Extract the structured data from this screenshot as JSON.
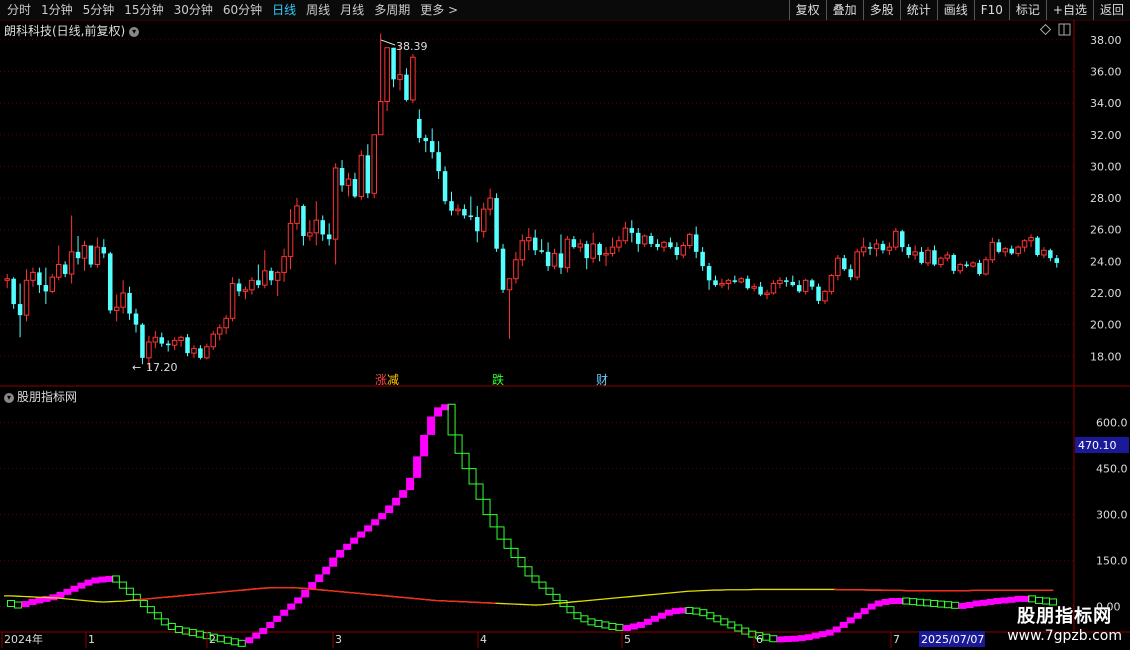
{
  "toolbar": {
    "periods": [
      {
        "label": "分时",
        "active": false
      },
      {
        "label": "1分钟",
        "active": false
      },
      {
        "label": "5分钟",
        "active": false
      },
      {
        "label": "15分钟",
        "active": false
      },
      {
        "label": "30分钟",
        "active": false
      },
      {
        "label": "60分钟",
        "active": false
      },
      {
        "label": "日线",
        "active": true
      },
      {
        "label": "周线",
        "active": false
      },
      {
        "label": "月线",
        "active": false
      },
      {
        "label": "多周期",
        "active": false
      },
      {
        "label": "更多 >",
        "active": false
      }
    ],
    "actions": [
      "复权",
      "叠加",
      "多股",
      "统计",
      "画线",
      "F10",
      "标记",
      "+自选",
      "返回"
    ]
  },
  "price_panel": {
    "title": "朗科科技(日线,前复权)",
    "high_label": "38.39",
    "low_label": "17.20",
    "axis_ticks": [
      "38.00",
      "36.00",
      "34.00",
      "32.00",
      "30.00",
      "28.00",
      "26.00",
      "24.00",
      "22.00",
      "20.00",
      "18.00"
    ],
    "events": [
      {
        "text": "涨",
        "color": "#ff4444"
      },
      {
        "text": "减",
        "color": "#ffcc00"
      },
      {
        "text": "跌",
        "color": "#33ff33"
      },
      {
        "text": "财",
        "color": "#66ccff"
      }
    ]
  },
  "indicator_panel": {
    "title": "股朋指标网",
    "axis_ticks": [
      "600.0",
      "450.0",
      "300.0",
      "150.0",
      "0.00"
    ],
    "current_value": "470.10"
  },
  "time_axis": {
    "labels": [
      "2024年",
      "1",
      "2",
      "3",
      "4",
      "5",
      "6",
      "7"
    ],
    "cursor_date": "2025/07/07"
  },
  "watermark": {
    "title": "股朋指标网",
    "url": "www.7gpzb.com"
  },
  "colors": {
    "up": "#ff3333",
    "down": "#54ffff",
    "pink": "#ff00ff",
    "green": "#33ff33",
    "grid": "#5a0000",
    "axis_border": "#8b0000"
  },
  "chart_data": {
    "type": "candlestick",
    "price_range": [
      16.5,
      39.0
    ],
    "indicator_range": [
      -60,
      700
    ],
    "price_ticks": [
      18,
      20,
      22,
      24,
      26,
      28,
      30,
      32,
      34,
      36,
      38
    ],
    "indicator_ticks": [
      0,
      150,
      300,
      450,
      600
    ],
    "candles": [
      [
        22.8,
        23.2,
        22.3,
        22.9
      ],
      [
        22.9,
        23.0,
        21.0,
        21.3
      ],
      [
        21.3,
        22.6,
        19.2,
        20.6
      ],
      [
        20.6,
        23.5,
        20.2,
        22.8
      ],
      [
        22.8,
        23.6,
        22.4,
        23.3
      ],
      [
        23.3,
        23.6,
        22.0,
        22.5
      ],
      [
        22.5,
        23.6,
        21.3,
        22.1
      ],
      [
        22.1,
        23.2,
        22.0,
        23.0
      ],
      [
        23.0,
        25.0,
        22.8,
        23.8
      ],
      [
        23.8,
        24.0,
        23.0,
        23.2
      ],
      [
        23.2,
        26.9,
        22.6,
        24.6
      ],
      [
        24.6,
        25.6,
        23.8,
        24.2
      ],
      [
        24.2,
        25.3,
        23.4,
        25.0
      ],
      [
        25.0,
        25.0,
        23.6,
        23.8
      ],
      [
        23.8,
        25.5,
        23.6,
        24.9
      ],
      [
        24.9,
        25.4,
        24.2,
        24.5
      ],
      [
        24.5,
        24.6,
        20.7,
        20.9
      ],
      [
        20.9,
        21.9,
        20.2,
        21.1
      ],
      [
        21.1,
        22.8,
        20.7,
        22.0
      ],
      [
        22.0,
        22.4,
        20.3,
        20.7
      ],
      [
        20.7,
        21.0,
        19.5,
        20.0
      ],
      [
        20.0,
        20.1,
        17.5,
        17.9
      ],
      [
        17.9,
        19.3,
        17.2,
        18.9
      ],
      [
        18.9,
        19.6,
        18.5,
        19.2
      ],
      [
        19.2,
        19.5,
        18.6,
        18.8
      ],
      [
        18.8,
        19.0,
        18.3,
        18.7
      ],
      [
        18.7,
        19.2,
        18.4,
        19.0
      ],
      [
        19.0,
        19.3,
        18.6,
        19.2
      ],
      [
        19.2,
        19.4,
        18.0,
        18.2
      ],
      [
        18.2,
        18.7,
        17.9,
        18.5
      ],
      [
        18.5,
        18.7,
        17.8,
        17.9
      ],
      [
        17.9,
        18.8,
        17.8,
        18.6
      ],
      [
        18.6,
        19.6,
        18.4,
        19.4
      ],
      [
        19.4,
        20.0,
        19.0,
        19.8
      ],
      [
        19.8,
        20.6,
        19.4,
        20.4
      ],
      [
        20.4,
        23.0,
        20.2,
        22.6
      ],
      [
        22.6,
        22.9,
        21.8,
        22.1
      ],
      [
        22.1,
        22.4,
        21.6,
        22.2
      ],
      [
        22.2,
        23.0,
        21.9,
        22.8
      ],
      [
        22.8,
        23.8,
        22.3,
        22.5
      ],
      [
        22.5,
        24.7,
        22.3,
        23.4
      ],
      [
        23.4,
        23.6,
        22.5,
        22.8
      ],
      [
        22.8,
        23.4,
        21.8,
        23.3
      ],
      [
        23.3,
        24.8,
        22.7,
        24.3
      ],
      [
        24.3,
        27.3,
        23.5,
        26.4
      ],
      [
        26.4,
        28.0,
        26.0,
        27.5
      ],
      [
        27.5,
        27.6,
        25.0,
        25.6
      ],
      [
        25.6,
        26.6,
        25.3,
        25.8
      ],
      [
        25.8,
        27.8,
        25.0,
        26.6
      ],
      [
        26.6,
        26.9,
        25.3,
        25.7
      ],
      [
        25.7,
        26.4,
        25.0,
        25.4
      ],
      [
        25.4,
        30.2,
        23.8,
        29.9
      ],
      [
        29.9,
        30.4,
        28.4,
        28.8
      ],
      [
        28.8,
        29.6,
        28.1,
        29.2
      ],
      [
        29.2,
        29.6,
        28.0,
        28.1
      ],
      [
        28.1,
        31.0,
        27.9,
        30.7
      ],
      [
        30.7,
        31.4,
        28.0,
        28.3
      ],
      [
        28.3,
        32.0,
        28.0,
        32.0
      ],
      [
        32.0,
        38.4,
        33.8,
        34.1
      ],
      [
        34.1,
        36.6,
        33.5,
        37.5
      ],
      [
        37.5,
        37.5,
        35.0,
        35.5
      ],
      [
        35.5,
        37.7,
        34.8,
        35.8
      ],
      [
        35.8,
        36.2,
        34.1,
        34.2
      ],
      [
        34.2,
        37.1,
        34.0,
        36.9
      ],
      [
        33.0,
        33.6,
        31.5,
        31.8
      ],
      [
        31.8,
        32.0,
        30.9,
        31.6
      ],
      [
        31.6,
        32.4,
        30.5,
        30.9
      ],
      [
        30.9,
        31.6,
        29.2,
        29.7
      ],
      [
        29.7,
        30.0,
        27.6,
        27.8
      ],
      [
        27.8,
        28.4,
        26.9,
        27.2
      ],
      [
        27.2,
        27.6,
        26.9,
        27.3
      ],
      [
        27.3,
        27.6,
        26.7,
        26.9
      ],
      [
        26.9,
        28.1,
        26.6,
        26.8
      ],
      [
        26.8,
        27.5,
        25.2,
        25.9
      ],
      [
        25.9,
        27.7,
        25.5,
        27.3
      ],
      [
        27.3,
        28.6,
        26.9,
        28.0
      ],
      [
        28.0,
        28.3,
        24.6,
        24.8
      ],
      [
        24.8,
        25.1,
        22.0,
        22.2
      ],
      [
        22.2,
        22.8,
        19.1,
        22.9
      ],
      [
        22.9,
        24.6,
        22.6,
        24.1
      ],
      [
        24.1,
        25.7,
        23.7,
        25.3
      ],
      [
        25.3,
        26.1,
        24.7,
        25.5
      ],
      [
        25.5,
        26.0,
        24.4,
        24.7
      ],
      [
        24.7,
        25.4,
        24.5,
        24.6
      ],
      [
        24.6,
        25.2,
        23.4,
        23.7
      ],
      [
        23.7,
        24.8,
        23.5,
        24.5
      ],
      [
        24.5,
        25.7,
        23.2,
        23.6
      ],
      [
        23.6,
        25.6,
        23.3,
        25.4
      ],
      [
        25.4,
        25.6,
        24.8,
        24.9
      ],
      [
        24.9,
        25.4,
        24.6,
        25.1
      ],
      [
        25.1,
        25.3,
        23.5,
        24.2
      ],
      [
        24.2,
        25.8,
        23.9,
        25.1
      ],
      [
        25.1,
        25.2,
        24.0,
        24.4
      ],
      [
        24.4,
        24.9,
        23.7,
        24.5
      ],
      [
        24.5,
        25.5,
        24.3,
        24.9
      ],
      [
        24.9,
        25.6,
        24.6,
        25.3
      ],
      [
        25.3,
        26.5,
        25.1,
        26.1
      ],
      [
        26.1,
        26.6,
        25.2,
        25.8
      ],
      [
        25.8,
        26.1,
        24.6,
        25.1
      ],
      [
        25.1,
        25.7,
        24.9,
        25.6
      ],
      [
        25.6,
        25.8,
        24.9,
        25.1
      ],
      [
        25.1,
        25.4,
        24.7,
        24.9
      ],
      [
        24.9,
        25.3,
        24.6,
        25.2
      ],
      [
        25.2,
        25.5,
        24.8,
        24.9
      ],
      [
        24.9,
        25.2,
        24.1,
        24.4
      ],
      [
        24.4,
        25.2,
        24.2,
        25.0
      ],
      [
        25.0,
        25.8,
        24.8,
        25.7
      ],
      [
        25.7,
        26.2,
        24.2,
        24.6
      ],
      [
        24.6,
        24.9,
        23.4,
        23.7
      ],
      [
        23.7,
        23.9,
        22.2,
        22.8
      ],
      [
        22.8,
        23.1,
        22.4,
        22.5
      ],
      [
        22.5,
        22.9,
        22.3,
        22.6
      ],
      [
        22.6,
        22.9,
        22.2,
        22.8
      ],
      [
        22.8,
        23.1,
        22.6,
        22.7
      ],
      [
        22.7,
        23.0,
        22.6,
        22.9
      ],
      [
        22.9,
        23.1,
        22.2,
        22.3
      ],
      [
        22.3,
        22.6,
        22.1,
        22.4
      ],
      [
        22.4,
        22.7,
        21.8,
        21.9
      ],
      [
        21.9,
        22.2,
        21.6,
        22.0
      ],
      [
        22.0,
        22.8,
        21.9,
        22.6
      ],
      [
        22.6,
        23.0,
        22.3,
        22.8
      ],
      [
        22.8,
        23.0,
        22.4,
        22.7
      ],
      [
        22.7,
        23.1,
        22.4,
        22.5
      ],
      [
        22.5,
        22.8,
        22.0,
        22.1
      ],
      [
        22.1,
        22.9,
        21.9,
        22.8
      ],
      [
        22.8,
        22.9,
        22.2,
        22.4
      ],
      [
        22.4,
        22.6,
        21.3,
        21.5
      ],
      [
        21.5,
        22.2,
        21.3,
        22.1
      ],
      [
        22.1,
        23.2,
        21.9,
        23.1
      ],
      [
        23.1,
        24.4,
        22.8,
        24.2
      ],
      [
        24.2,
        24.4,
        23.4,
        23.5
      ],
      [
        23.5,
        23.8,
        22.8,
        23.0
      ],
      [
        23.0,
        24.8,
        22.8,
        24.6
      ],
      [
        24.6,
        25.5,
        24.3,
        24.9
      ],
      [
        24.9,
        25.2,
        24.4,
        24.8
      ],
      [
        24.8,
        25.4,
        24.3,
        25.1
      ],
      [
        25.1,
        25.3,
        24.5,
        24.7
      ],
      [
        24.7,
        25.2,
        24.4,
        24.9
      ],
      [
        24.9,
        26.1,
        24.7,
        25.9
      ],
      [
        25.9,
        26.0,
        24.6,
        24.9
      ],
      [
        24.9,
        25.1,
        24.2,
        24.4
      ],
      [
        24.4,
        25.0,
        24.1,
        24.6
      ],
      [
        24.6,
        24.9,
        23.8,
        23.9
      ],
      [
        23.9,
        24.9,
        23.7,
        24.7
      ],
      [
        24.7,
        25.0,
        23.7,
        23.8
      ],
      [
        23.8,
        24.3,
        23.6,
        24.2
      ],
      [
        24.2,
        24.6,
        24.0,
        24.4
      ],
      [
        24.4,
        24.5,
        23.2,
        23.4
      ],
      [
        23.4,
        23.9,
        23.2,
        23.8
      ],
      [
        23.8,
        24.0,
        23.6,
        23.7
      ],
      [
        23.7,
        24.0,
        23.6,
        23.9
      ],
      [
        23.9,
        24.1,
        23.1,
        23.2
      ],
      [
        23.2,
        24.3,
        23.1,
        24.1
      ],
      [
        24.1,
        25.5,
        23.9,
        25.2
      ],
      [
        25.2,
        25.4,
        24.5,
        24.6
      ],
      [
        24.6,
        24.9,
        24.3,
        24.8
      ],
      [
        24.8,
        25.0,
        24.4,
        24.5
      ],
      [
        24.5,
        25.0,
        24.3,
        24.9
      ],
      [
        24.9,
        25.4,
        24.6,
        25.3
      ],
      [
        25.3,
        25.7,
        24.9,
        25.5
      ],
      [
        25.5,
        25.6,
        24.3,
        24.4
      ],
      [
        24.4,
        24.9,
        24.2,
        24.7
      ],
      [
        24.7,
        24.8,
        24.0,
        24.2
      ],
      [
        24.2,
        24.4,
        23.6,
        23.9
      ]
    ],
    "indicator_fast": [
      20,
      15,
      12,
      18,
      25,
      30,
      35,
      40,
      48,
      58,
      68,
      78,
      88,
      95,
      98,
      100,
      80,
      60,
      40,
      20,
      0,
      -20,
      -40,
      -55,
      -65,
      -70,
      -75,
      -80,
      -85,
      -90,
      -95,
      -100,
      -105,
      -110,
      -115,
      -100,
      -85,
      -70,
      -50,
      -30,
      -10,
      10,
      30,
      55,
      80,
      105,
      130,
      160,
      185,
      205,
      225,
      245,
      265,
      285,
      305,
      330,
      355,
      380,
      420,
      490,
      560,
      620,
      650,
      660,
      560,
      500,
      450,
      400,
      350,
      300,
      260,
      220,
      190,
      160,
      130,
      100,
      80,
      60,
      40,
      20,
      0,
      -20,
      -30,
      -40,
      -45,
      -50,
      -55,
      -58,
      -60,
      -60,
      -55,
      -50,
      -40,
      -30,
      -20,
      -10,
      -5,
      -3,
      -5,
      -10,
      -20,
      -30,
      -40,
      -50,
      -60,
      -70,
      -80,
      -85,
      -90,
      -95,
      -97,
      -97,
      -96,
      -95,
      -93,
      -90,
      -85,
      -80,
      -75,
      -65,
      -50,
      -35,
      -20,
      -5,
      10,
      20,
      25,
      28,
      28,
      26,
      24,
      22,
      20,
      18,
      16,
      14,
      12,
      12,
      15,
      20,
      22,
      25,
      28,
      30,
      32,
      35,
      35,
      30,
      28,
      25,
      22
    ],
    "ma_long": [
      35,
      35,
      34,
      33,
      32,
      31,
      30,
      29,
      28,
      26,
      24,
      22,
      20,
      18,
      16,
      15,
      16,
      17,
      18,
      20,
      22,
      24,
      26,
      28,
      30,
      32,
      34,
      36,
      38,
      40,
      42,
      44,
      46,
      48,
      50,
      52,
      54,
      56,
      58,
      60,
      61,
      62,
      62,
      62,
      61,
      60,
      58,
      56,
      54,
      52,
      50,
      48,
      46,
      44,
      42,
      40,
      38,
      36,
      34,
      32,
      30,
      28,
      26,
      24,
      22,
      20,
      19,
      18,
      17,
      16,
      15,
      14,
      13,
      12,
      11,
      10,
      9,
      8,
      7,
      6,
      5,
      6,
      8,
      10,
      12,
      14,
      16,
      18,
      20,
      22,
      24,
      26,
      28,
      30,
      32,
      34,
      36,
      38,
      40,
      42,
      44,
      46,
      48,
      50,
      51,
      52,
      53,
      54,
      54,
      55,
      55,
      55,
      55,
      56,
      56,
      56,
      56,
      56,
      56,
      56,
      56,
      56,
      56,
      56,
      56,
      56,
      55,
      55,
      55,
      55,
      54,
      54,
      54,
      53,
      53,
      53,
      52,
      52,
      52,
      52,
      52,
      52,
      52,
      52,
      52,
      52,
      53,
      53,
      53,
      53,
      53,
      53,
      53,
      53,
      53,
      53,
      53,
      53,
      53
    ]
  }
}
